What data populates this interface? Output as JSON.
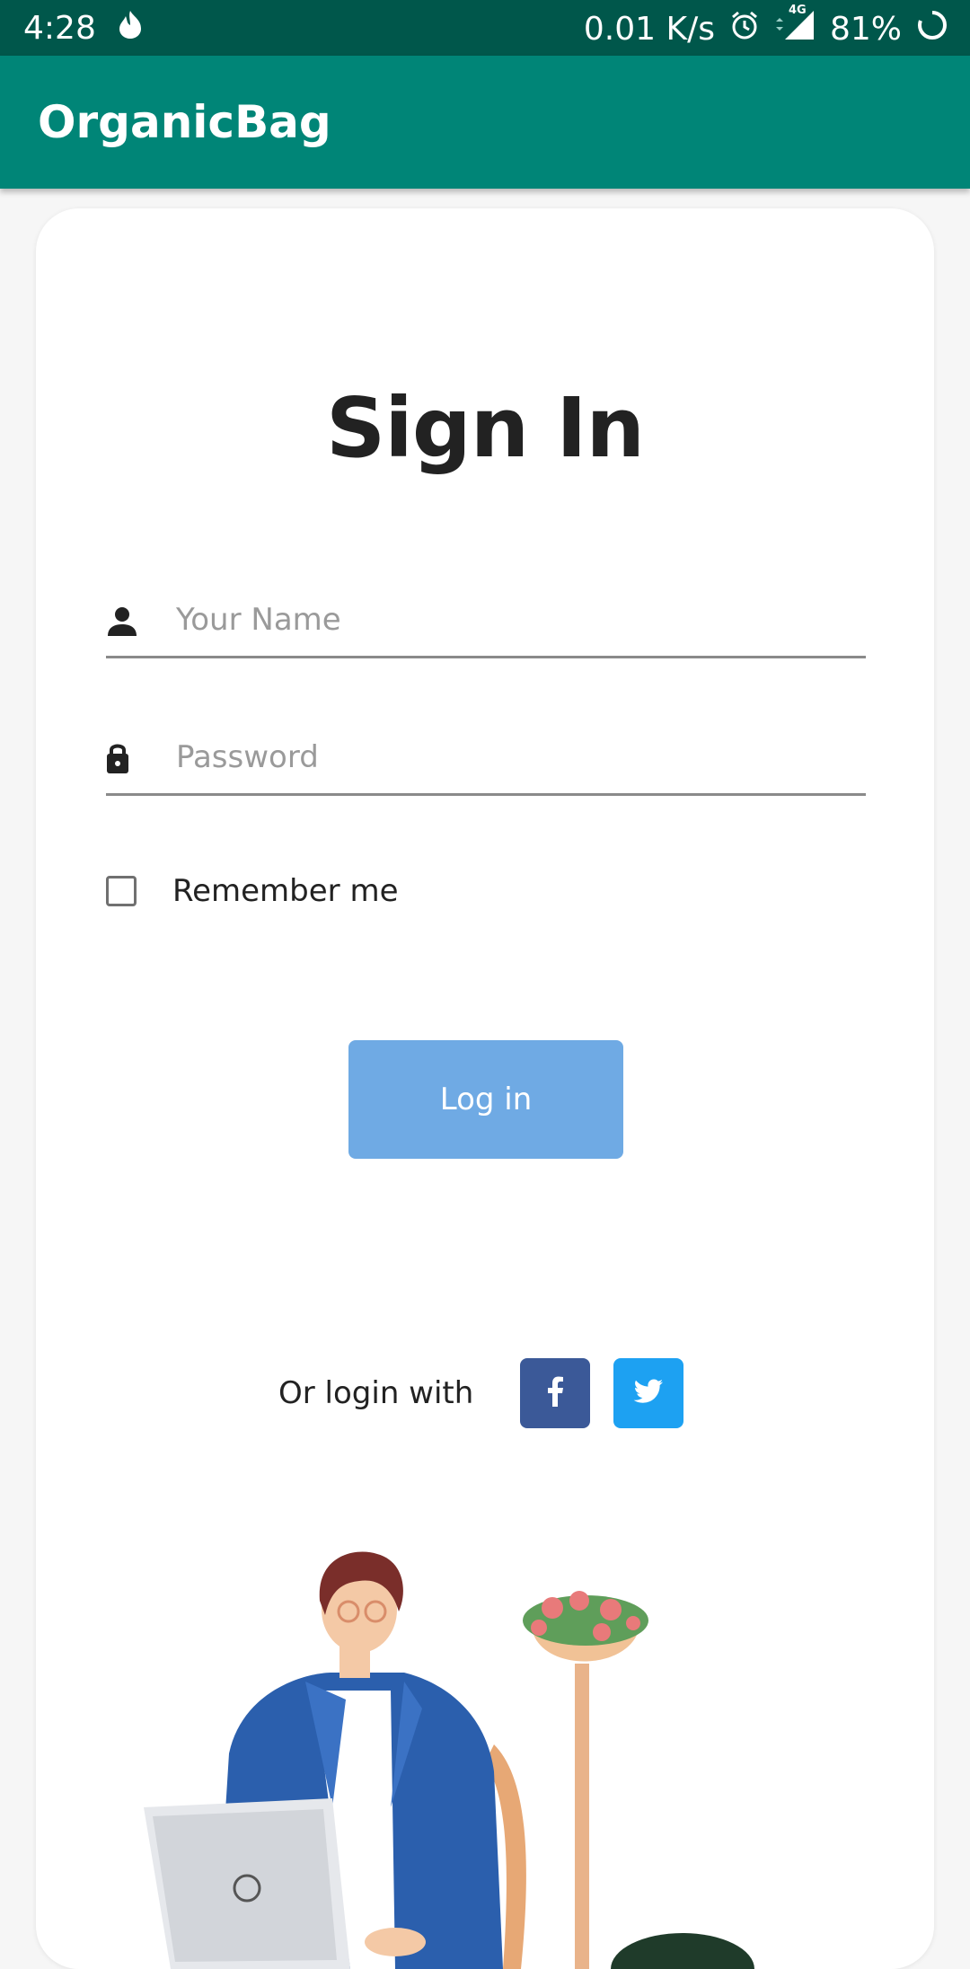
{
  "status_bar": {
    "time": "4:28",
    "network_speed": "0.01 K/s",
    "network_type": "4G",
    "battery": "81%",
    "icons": [
      "flame-icon",
      "alarm-icon",
      "signal-icon",
      "battery-icon"
    ]
  },
  "app_bar": {
    "title": "OrganicBag"
  },
  "form": {
    "heading": "Sign In",
    "name_placeholder": "Your Name",
    "name_value": "",
    "password_placeholder": "Password",
    "password_value": "",
    "remember_label": "Remember me",
    "remember_checked": false,
    "login_label": "Log in"
  },
  "social": {
    "label": "Or login with",
    "facebook_icon": "f",
    "twitter_icon": "twitter-bird-icon"
  },
  "colors": {
    "status_bar": "#00574b",
    "app_bar": "#008577",
    "login_button": "#6faae4",
    "facebook": "#3b5998",
    "twitter": "#1da1f2"
  }
}
